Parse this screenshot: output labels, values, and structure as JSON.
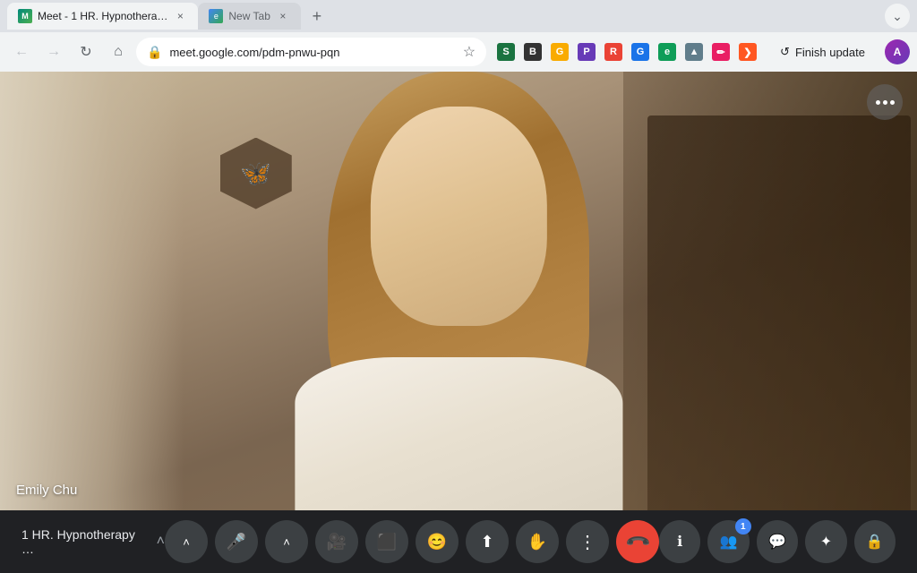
{
  "browser": {
    "tabs": [
      {
        "id": "meet-tab",
        "favicon_type": "meet",
        "label": "Meet - 1 HR. Hypnothera…",
        "active": true,
        "close_label": "×"
      },
      {
        "id": "new-tab",
        "favicon_type": "chrome",
        "label": "New Tab",
        "active": false,
        "close_label": "×"
      }
    ],
    "new_tab_label": "+",
    "extensions_btn_label": "⌄",
    "address_bar": {
      "lock_icon": "🔒",
      "url": "meet.google.com/pdm-pnwu-pqn",
      "star_icon": "☆"
    },
    "toolbar": {
      "finish_update_label": "Finish update",
      "finish_update_icon": "↺"
    },
    "profile_initials": "A"
  },
  "meet": {
    "more_btn_dots": [
      "•",
      "•",
      "•"
    ],
    "participant": {
      "name": "Emily Chu"
    },
    "controls": {
      "meeting_title": "1 HR. Hypnotherapy …",
      "chevron_up_icon": "˄",
      "mic_icon": "🎤",
      "camera_icon": "📷",
      "present_icon": "⬛",
      "emoji_icon": "😊",
      "share_icon": "⬆",
      "hand_icon": "✋",
      "more_icon": "⋮",
      "end_call_icon": "📞",
      "info_icon": "ⓘ",
      "people_icon": "👥",
      "chat_icon": "💬",
      "activities_icon": "✦",
      "lock_icon": "🔒",
      "people_badge": "1"
    }
  }
}
